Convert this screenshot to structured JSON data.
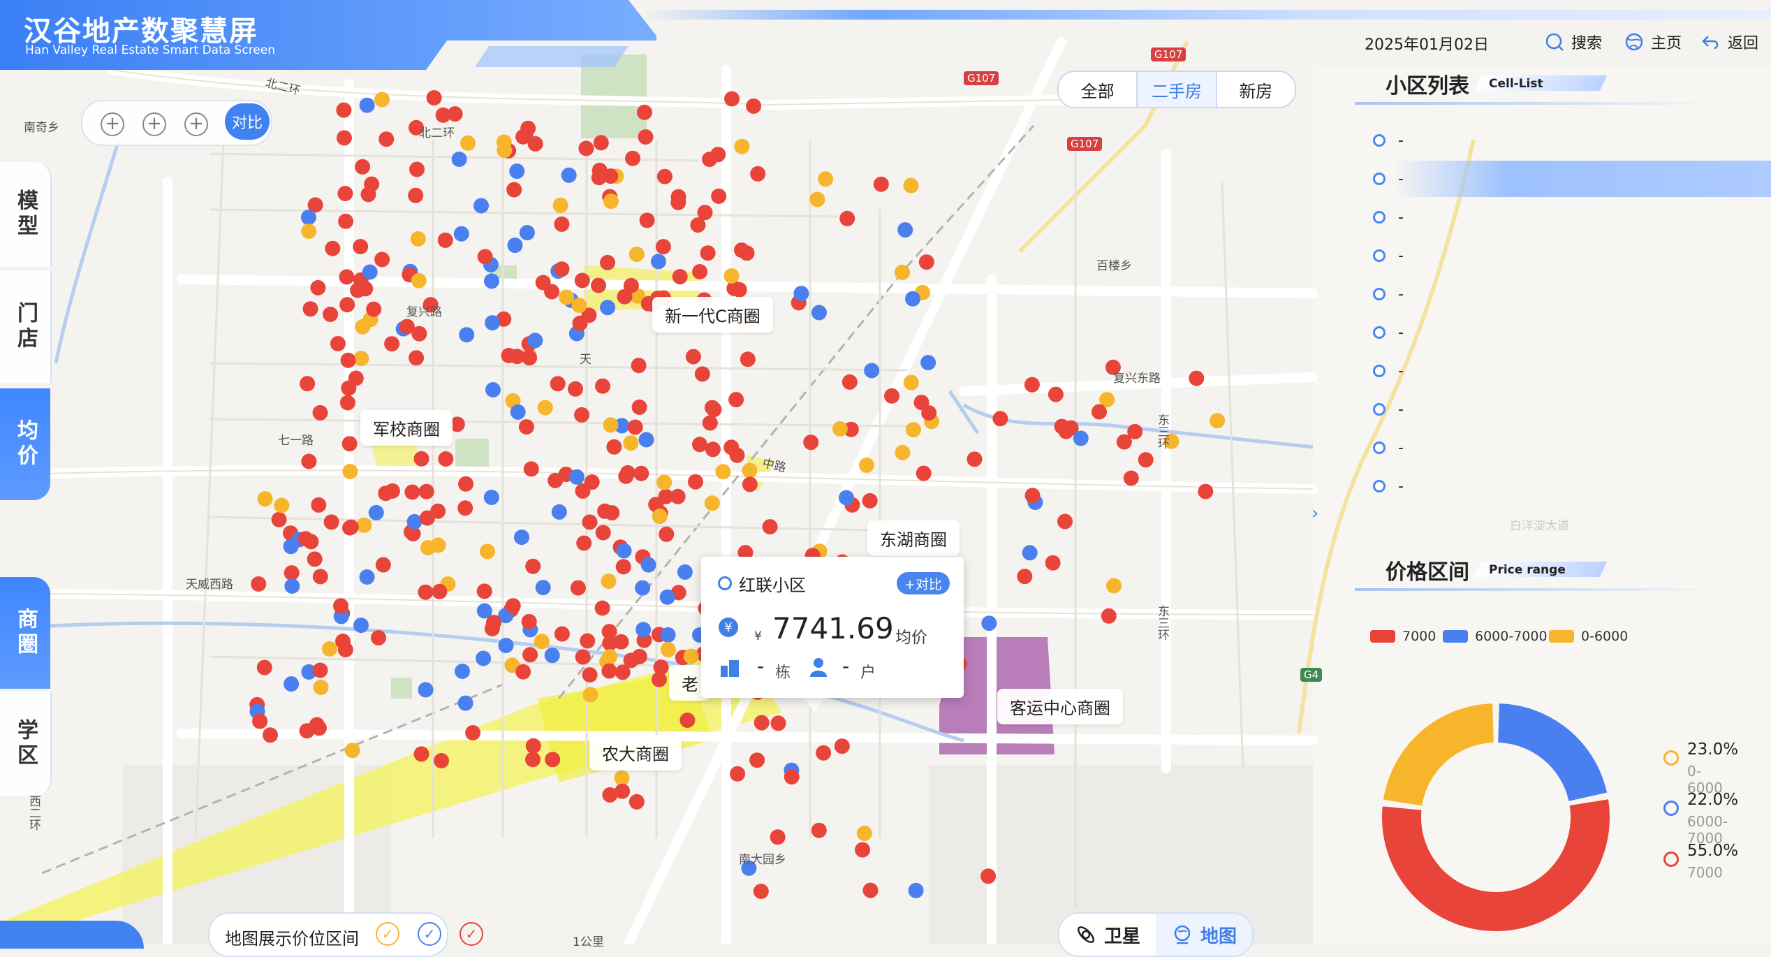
{
  "app": {
    "title": "汉谷地产数聚慧屏",
    "subtitle": "Han Valley Real Estate Smart Data Screen"
  },
  "header": {
    "date": "2025年01月02日",
    "search_label": "搜索",
    "home_label": "主页",
    "back_label": "返回"
  },
  "sidebar": {
    "items": [
      {
        "label": "模型",
        "active": false
      },
      {
        "label": "门店",
        "active": false
      },
      {
        "label": "均价",
        "active": true
      },
      {
        "label": "商圈",
        "active": true
      },
      {
        "label": "学区",
        "active": false
      }
    ]
  },
  "map_controls": {
    "compare_label": "对比"
  },
  "filters": {
    "tabs": [
      {
        "label": "全部",
        "active": false
      },
      {
        "label": "二手房",
        "active": true
      },
      {
        "label": "新房",
        "active": false
      }
    ]
  },
  "cell_list": {
    "title": "小区列表",
    "subtitle": "Cell-List",
    "items": [
      "-",
      "-",
      "-",
      "-",
      "-",
      "-",
      "-",
      "-",
      "-",
      "-"
    ]
  },
  "price_range": {
    "title": "价格区间",
    "subtitle": "Price range",
    "legend": [
      {
        "label": "7000",
        "color": "#e8443a"
      },
      {
        "label": "6000-7000",
        "color": "#4a7ff0"
      },
      {
        "label": "0-6000",
        "color": "#f7b52c"
      }
    ],
    "stats": [
      {
        "pct": "23.0%",
        "label": "0-6000",
        "color": "#f7b52c"
      },
      {
        "pct": "22.0%",
        "label": "6000-7000",
        "color": "#4a7ff0"
      },
      {
        "pct": "55.0%",
        "label": "7000",
        "color": "#e8443a"
      }
    ]
  },
  "chart_data": {
    "type": "pie",
    "categories": [
      "0-6000",
      "6000-7000",
      "7000"
    ],
    "values": [
      23.0,
      22.0,
      55.0
    ],
    "colors": [
      "#f7b52c",
      "#4a7ff0",
      "#e8443a"
    ],
    "title": "",
    "legend": "right"
  },
  "map": {
    "business_areas": [
      "新一代C商圈",
      "军校商圈",
      "东湖商圈",
      "老",
      "农大商圈",
      "客运中心商圈"
    ],
    "roads": [
      "北二环",
      "北二环",
      "复兴路",
      "天",
      "七一路",
      "天威西路",
      "中路",
      "复兴东路",
      "东三环",
      "东三环",
      "南大园乡",
      "百楼乡",
      "南奇乡",
      "白洋淀大道",
      "西二环",
      "G107",
      "G107",
      "G107",
      "G4",
      "1公里"
    ]
  },
  "popup": {
    "name": "红联小区",
    "compare_label": "+对比",
    "currency": "¥",
    "price": "7741.69",
    "price_unit": "均价",
    "buildings_value": "-",
    "buildings_unit": "栋",
    "households_value": "-",
    "households_unit": "户"
  },
  "bottom": {
    "legend_label": "地图展示价位区间",
    "view_satellite": "卫星",
    "view_map": "地图"
  }
}
